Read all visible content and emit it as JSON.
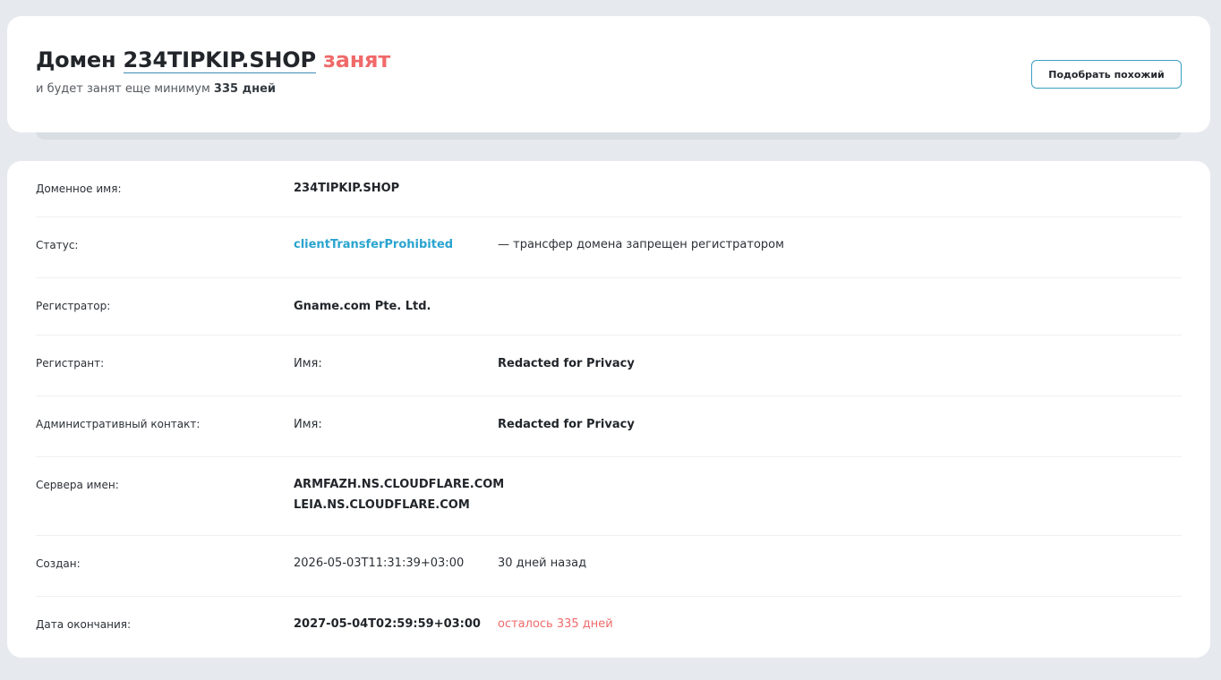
{
  "header": {
    "title_prefix": "Домен",
    "domain": "234TIPKIP.SHOP",
    "status_word": "занят",
    "subtitle_prefix": "и будет занят еще минимум",
    "subtitle_days": "335 дней",
    "similar_button": "Подобрать похожий"
  },
  "info": {
    "domain_name": {
      "label": "Доменное имя:",
      "value": "234TIPKIP.SHOP"
    },
    "status": {
      "label": "Статус:",
      "value": "clientTransferProhibited",
      "description": "— трансфер домена запрещен регистратором"
    },
    "registrar": {
      "label": "Регистратор:",
      "value": "Gname.com Pte. Ltd."
    },
    "registrant": {
      "label": "Регистрант:",
      "field": "Имя:",
      "value": "Redacted for Privacy"
    },
    "admin_contact": {
      "label": "Административный контакт:",
      "field": "Имя:",
      "value": "Redacted for Privacy"
    },
    "name_servers": {
      "label": "Сервера имен:",
      "values": [
        "ARMFAZH.NS.CLOUDFLARE.COM",
        "LEIA.NS.CLOUDFLARE.COM"
      ]
    },
    "created": {
      "label": "Создан:",
      "value": "2026-05-03T11:31:39+03:00",
      "relative": "30 дней назад"
    },
    "expiry": {
      "label": "Дата окончания:",
      "value": "2027-05-04T02:59:59+03:00",
      "remaining": "осталось 335 дней"
    }
  },
  "colors": {
    "background": "#e6eaee",
    "accent_red": "#f06a6a",
    "link_blue": "#2aa4cf",
    "button_border": "#3a9fc1"
  }
}
